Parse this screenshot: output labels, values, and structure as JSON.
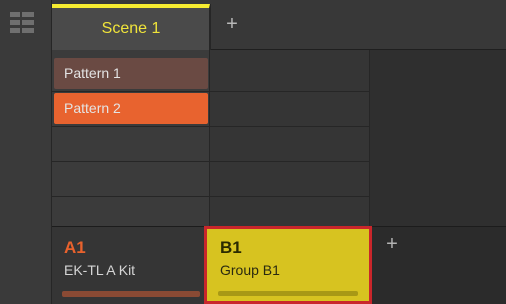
{
  "scenes": {
    "tabs": [
      {
        "label": "Scene 1"
      }
    ],
    "add_label": "+"
  },
  "patterns": [
    {
      "label": "Pattern 1"
    },
    {
      "label": "Pattern 2"
    }
  ],
  "groups": {
    "items": [
      {
        "code": "A1",
        "name": "EK-TL A Kit"
      },
      {
        "code": "B1",
        "name": "Group B1"
      }
    ],
    "add_label": "+"
  },
  "colors": {
    "scene_accent": "#f6ec31",
    "pattern_1": "#6a4a43",
    "pattern_2": "#e8632f",
    "group_a1": "#e9622d",
    "group_b1": "#d7c320",
    "highlight_frame": "#c9262b"
  }
}
